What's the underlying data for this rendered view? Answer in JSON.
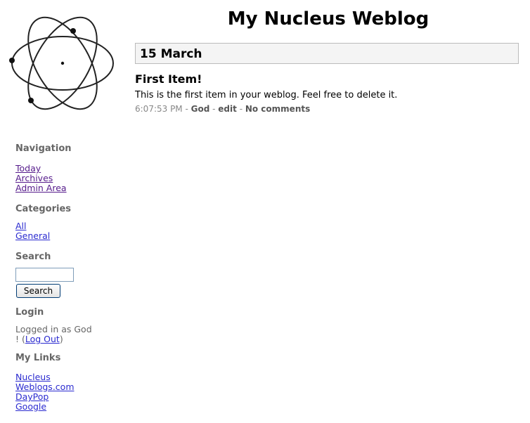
{
  "site": {
    "title": "My Nucleus Weblog"
  },
  "date_header": "15 March",
  "item": {
    "title": "First Item!",
    "body": "This is the first item in your weblog. Feel free to delete it.",
    "time": "6:07:53 PM",
    "author": "God",
    "edit": "edit",
    "comments": "No comments",
    "sep": " - "
  },
  "sidebar": {
    "navigation": {
      "heading": "Navigation",
      "links": [
        "Today",
        "Archives",
        "Admin Area"
      ]
    },
    "categories": {
      "heading": "Categories",
      "links": [
        "All",
        "General"
      ]
    },
    "search": {
      "heading": "Search",
      "button": "Search"
    },
    "login": {
      "heading": "Login",
      "text_prefix": "Logged in as God",
      "text_after": "! (",
      "logout": "Log Out",
      "close": ")"
    },
    "links": {
      "heading": "My Links",
      "items": [
        "Nucleus",
        "Weblogs.com",
        "DayPop",
        "Google"
      ]
    }
  }
}
